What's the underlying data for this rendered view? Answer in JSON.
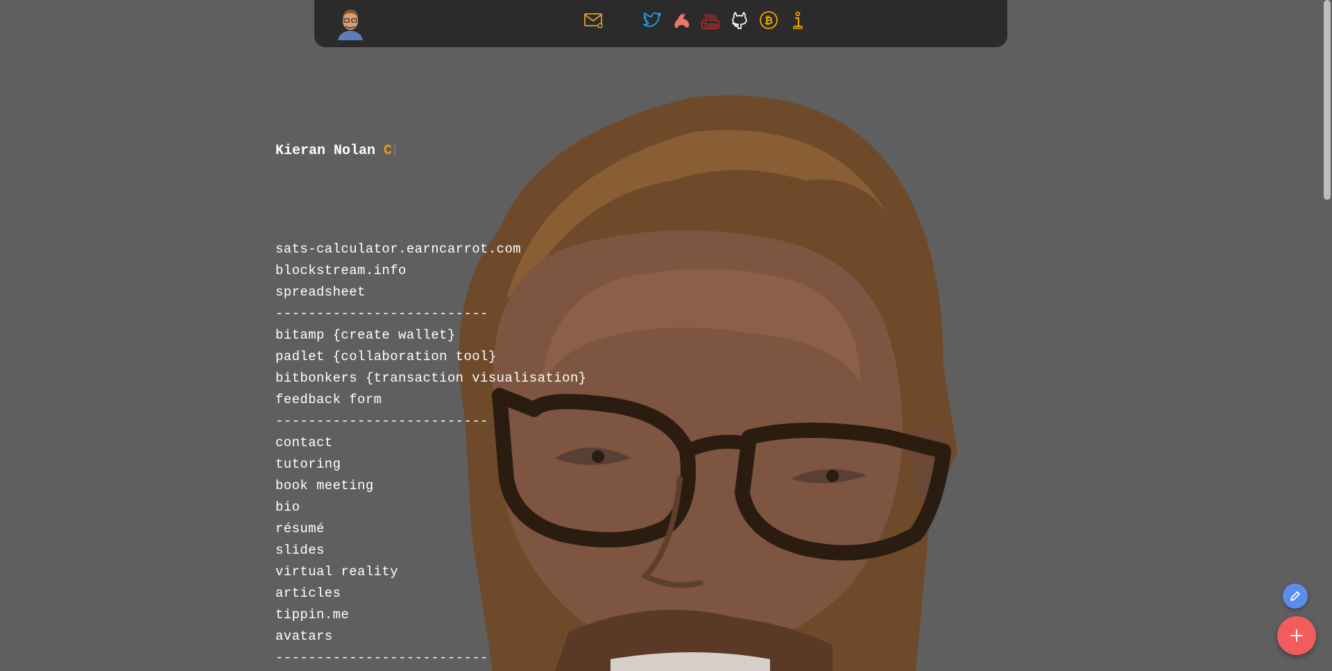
{
  "profile": {
    "name": "Kieran Nolan",
    "mark": "C"
  },
  "topbar": {
    "icons": [
      "email-icon",
      "twitter-icon",
      "nostr-icon",
      "youtube-icon",
      "github-icon",
      "bitcoin-icon",
      "info-icon"
    ],
    "colors": {
      "email": "#e0a030",
      "twitter": "#1da1f2",
      "nostr": "#e8786a",
      "youtube": "#d82a2a",
      "github": "#ffffff",
      "bitcoin": "#f2a900",
      "info": "#f2a900"
    }
  },
  "links": [
    "sats-calculator.earncarrot.com",
    "blockstream.info",
    "spreadsheet",
    "--------------------------",
    "bitamp {create wallet}",
    "padlet {collaboration tool}",
    "bitbonkers {transaction visualisation}",
    "feedback form",
    "--------------------------",
    "contact",
    "tutoring",
    "book meeting",
    "bio",
    "résumé",
    "slides",
    "virtual reality",
    "articles",
    "tippin.me",
    "avatars",
    "--------------------------"
  ],
  "colors": {
    "background": "#5f5f5f",
    "topbar": "#2b2b2b",
    "accent": "#f39c12",
    "fab_edit": "#5b8def",
    "fab_add": "#f25c5c"
  }
}
